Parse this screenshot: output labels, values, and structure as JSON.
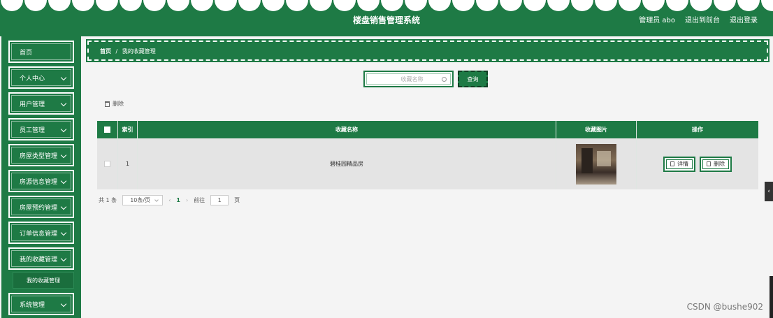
{
  "header": {
    "title": "楼盘销售管理系统",
    "user_label": "管理员 abo",
    "to_front_label": "退出到前台",
    "logout_label": "退出登录",
    "accent_color": "#1e7a45"
  },
  "sidebar": {
    "items": [
      {
        "label": "首页"
      },
      {
        "label": "个人中心"
      },
      {
        "label": "用户管理"
      },
      {
        "label": "员工管理"
      },
      {
        "label": "房屋类型管理"
      },
      {
        "label": "房源信息管理"
      },
      {
        "label": "房屋预约管理"
      },
      {
        "label": "订单信息管理"
      },
      {
        "label": "我的收藏管理"
      },
      {
        "label": "系统管理"
      }
    ],
    "submenu": {
      "label": "我的收藏管理"
    }
  },
  "breadcrumb": {
    "home": "首页",
    "separator": "/",
    "current": "我的收藏管理"
  },
  "search": {
    "placeholder": "收藏名称",
    "button_label": "查询"
  },
  "toolbar": {
    "delete_label": "删除"
  },
  "table": {
    "columns": [
      "索引",
      "收藏名称",
      "收藏图片",
      "操作"
    ],
    "rows": [
      {
        "index": "1",
        "name": "碧桂园精品房",
        "detail_label": "详情",
        "delete_label": "删除"
      }
    ]
  },
  "pagination": {
    "total": "共 1 条",
    "page_size": "10条/页",
    "prev": "‹",
    "current": "1",
    "next": "›",
    "goto_label": "前往",
    "goto_value": "1",
    "page_suffix": "页"
  },
  "side_tab": "‹",
  "watermark": "CSDN @bushe902"
}
